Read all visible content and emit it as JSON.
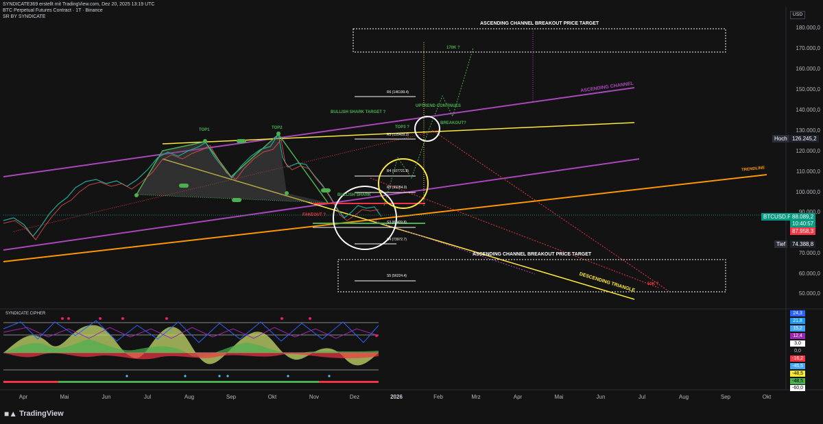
{
  "header": {
    "publisher": "SYNDICATE369 erstellt mit TradingView.com, Dez 20, 2025 13:19 UTC",
    "symbol": "BTC Perpetual Futures Contract · 1T · Binance",
    "indicator": "SR BY SYNDICATE"
  },
  "currency": "USD",
  "price_axis": [
    "180.000,0",
    "170.000,0",
    "160.000,0",
    "150.000,0",
    "140.000,0",
    "130.000,0",
    "120.000,0",
    "110.000,0",
    "100.000,0",
    "90.000,0",
    "70.000,0",
    "60.000,0",
    "50.000,0"
  ],
  "tags": {
    "high_label": "Hoch",
    "high_value": "126.245,2",
    "symbol_label": "BTCUSD.P",
    "last_price": "88.089,2",
    "countdown": "10:40:57",
    "bid": "87.958,3",
    "low_label": "Tief",
    "low_value": "74.388,8"
  },
  "annotations": {
    "asc_breakout_top": "ASCENDING CHANNEL BREAKOUT  PRICE TARGET",
    "asc_breakout_bottom": "ASCENDING CHANNEL BREAKOUT  PRICE TARGET",
    "ascending_channel": "ASCENDING CHANNEL",
    "trendline": "TRENDLINE",
    "descending_triangle": "DESCENDING TRIANGLE",
    "top1": "TOP1",
    "top2": "TOP2",
    "top3": "TOP3 ?",
    "breakout": "BREAKOUT?",
    "uptrend": "UPTREND CONTINUES",
    "bullish_shark_target": "BULLISH SHARK TARGET ?",
    "bullish_shark": "BULLISH SHARK",
    "fakeout": "FAKEOUT ?",
    "target_170k": "170K ?",
    "target_50k": "50K ?",
    "r6": "R6 (146199.4)",
    "r5": "R5 (125409.3)",
    "r4": "R4 (107721.8)",
    "r3": "R3 (99284.0)",
    "s3": "S3 (82409.8)",
    "s4": "S4 (73972.7)",
    "s5": "S5 (56224.4)"
  },
  "indicator_panel": {
    "title": "SYNDICATE CIPHER",
    "values": [
      {
        "v": "24,3",
        "bg": "#2962ff",
        "fg": "#ffffff"
      },
      {
        "v": "21,8",
        "bg": "#2196f3",
        "fg": "#ffffff"
      },
      {
        "v": "15,2",
        "bg": "#42a5f5",
        "fg": "#ffffff"
      },
      {
        "v": "12,4",
        "bg": "#9c27b0",
        "fg": "#ffffff"
      },
      {
        "v": "3,0",
        "bg": "#ffffff",
        "fg": "#000000"
      },
      {
        "v": "0,0",
        "bg": "#131313",
        "fg": "#d1d4dc"
      },
      {
        "v": "-16,2",
        "bg": "#f23645",
        "fg": "#ffffff"
      },
      {
        "v": "-45,5",
        "bg": "#42a5f5",
        "fg": "#ffffff"
      },
      {
        "v": "-48,5",
        "bg": "#ffeb3b",
        "fg": "#000000"
      },
      {
        "v": "-48,5",
        "bg": "#4caf50",
        "fg": "#000000"
      },
      {
        "v": "-60,0",
        "bg": "#ffffff",
        "fg": "#000000"
      }
    ]
  },
  "time_axis": [
    "Apr",
    "Mai",
    "Jun",
    "Jul",
    "Aug",
    "Sep",
    "Okt",
    "Nov",
    "Dez",
    "2026",
    "Feb",
    "Mrz",
    "Apr",
    "Mai",
    "Jun",
    "Jul",
    "Aug",
    "Sep",
    "Okt"
  ],
  "footer": {
    "brand": "TradingView"
  },
  "colors": {
    "background": "#131313",
    "yellow": "#ffeb3b",
    "purple": "#ab47bc",
    "orange": "#ff9800",
    "green": "#4caf50",
    "red": "#f23645",
    "teal": "#089981"
  }
}
